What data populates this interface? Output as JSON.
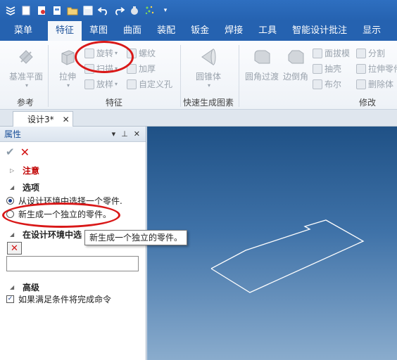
{
  "tabs": [
    "菜单",
    "特征",
    "草图",
    "曲面",
    "装配",
    "钣金",
    "焊接",
    "工具",
    "智能设计批注",
    "显示"
  ],
  "ribbon": {
    "ref_group": "参考",
    "feature_group": "特征",
    "quick_group": "快速生成图素",
    "modify_group": "修改",
    "datum_plane": "基准平面",
    "extrude": "拉伸",
    "revolve": "旋转",
    "sweep": "扫描",
    "loft": "放样",
    "thread": "螺纹",
    "thicken": "加厚",
    "custom_hole": "自定义孔",
    "cone": "圆锥体",
    "fillet": "圆角过渡",
    "chamfer": "边倒角",
    "draft": "面拔模",
    "shell": "抽壳",
    "boolean": "布尔",
    "split": "分割",
    "extrude_part": "拉伸零件",
    "delete_body": "删除体"
  },
  "document_tab": "设计3*",
  "panel": {
    "title": "属性",
    "notice": "注意",
    "options": "选项",
    "option1": "从设计环境中选择一个零件.",
    "option2": "新生成一个独立的零件。",
    "select_section": "在设计环境中选",
    "advanced": "高级",
    "auto_complete": "如果满足条件将完成命令"
  },
  "tooltip": "新生成一个独立的零件。"
}
